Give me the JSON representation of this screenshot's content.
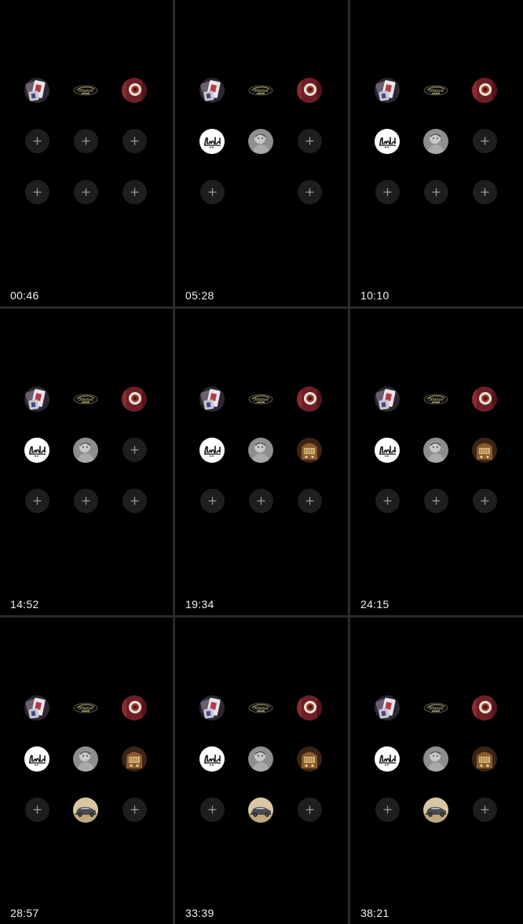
{
  "colors": {
    "background": "#000000",
    "frame_divider": "#2a2a2a",
    "add_button": "#1e1e1e",
    "add_icon": "#9a9a9a",
    "timestamp_text": "#f2f2f2"
  },
  "frames": [
    {
      "timestamp": "00:46",
      "grid": [
        "playing-cards",
        "car-logo",
        "rose-round",
        "add",
        "add",
        "add",
        "add",
        "add",
        "add"
      ]
    },
    {
      "timestamp": "05:28",
      "grid": [
        "playing-cards",
        "car-logo",
        "rose-round",
        "arabic-calligraphy",
        "gray-portrait",
        "add",
        "add",
        "empty",
        "add"
      ]
    },
    {
      "timestamp": "10:10",
      "grid": [
        "playing-cards",
        "car-logo",
        "rose-round",
        "arabic-calligraphy",
        "gray-portrait",
        "add",
        "add",
        "add",
        "add"
      ]
    },
    {
      "timestamp": "14:52",
      "grid": [
        "playing-cards",
        "car-logo",
        "rose-round",
        "arabic-calligraphy",
        "gray-portrait",
        "add",
        "add",
        "add",
        "add"
      ]
    },
    {
      "timestamp": "19:34",
      "grid": [
        "playing-cards",
        "car-logo",
        "rose-round",
        "arabic-calligraphy",
        "gray-portrait",
        "vintage-radio",
        "add",
        "add",
        "add"
      ]
    },
    {
      "timestamp": "24:15",
      "grid": [
        "playing-cards",
        "car-logo",
        "rose-round",
        "arabic-calligraphy",
        "gray-portrait",
        "vintage-radio",
        "add",
        "add",
        "add"
      ]
    },
    {
      "timestamp": "28:57",
      "grid": [
        "playing-cards",
        "car-logo",
        "rose-round",
        "arabic-calligraphy",
        "gray-portrait",
        "vintage-radio",
        "add",
        "classic-car",
        "add"
      ]
    },
    {
      "timestamp": "33:39",
      "grid": [
        "playing-cards",
        "car-logo",
        "rose-round",
        "arabic-calligraphy",
        "gray-portrait",
        "vintage-radio",
        "add",
        "classic-car",
        "add"
      ]
    },
    {
      "timestamp": "38:21",
      "grid": [
        "playing-cards",
        "car-logo",
        "rose-round",
        "arabic-calligraphy",
        "gray-portrait",
        "vintage-radio",
        "add",
        "classic-car",
        "add"
      ]
    }
  ]
}
